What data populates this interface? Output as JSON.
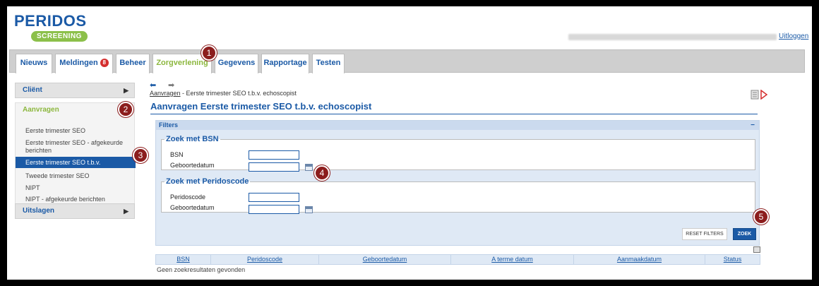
{
  "header": {
    "logo_main": "PERIDOS",
    "logo_sub": "SCREENING",
    "logout": "Uitloggen"
  },
  "tabs": [
    {
      "label": "Nieuws"
    },
    {
      "label": "Meldingen",
      "badge": "8"
    },
    {
      "label": "Beheer"
    },
    {
      "label": "Zorgverlening",
      "active": true
    },
    {
      "label": "Gegevens"
    },
    {
      "label": "Rapportage"
    },
    {
      "label": "Testen"
    }
  ],
  "sidebar": {
    "client": "Cliënt",
    "aanvragen": "Aanvragen",
    "items": [
      "Eerste trimester SEO",
      "Eerste trimester SEO - afgekeurde berichten",
      "Eerste trimester SEO t.b.v. echoscopist",
      "Tweede trimester SEO",
      "NIPT",
      "NIPT - afgekeurde berichten"
    ],
    "uitslagen": "Uitslagen"
  },
  "breadcrumb": {
    "link": "Aanvragen",
    "rest": " - Eerste trimester SEO t.b.v. echoscopist"
  },
  "page_title": "Aanvragen Eerste trimester SEO t.b.v. echoscopist",
  "filters": {
    "title": "Filters",
    "toggle": "−",
    "bsn_group": {
      "legend": "Zoek met BSN",
      "bsn_label": "BSN",
      "dob_label": "Geboortedatum"
    },
    "peridos_group": {
      "legend": "Zoek met Peridoscode",
      "code_label": "Peridoscode",
      "dob_label": "Geboortedatum"
    },
    "reset_label": "RESET FILTERS",
    "zoek_label": "ZOEK"
  },
  "results": {
    "columns": [
      "BSN",
      "Peridoscode",
      "Geboortedatum",
      "A terme datum",
      "Aanmaakdatum",
      "Status"
    ],
    "empty": "Geen zoekresultaten gevonden"
  },
  "callouts": [
    "1",
    "2",
    "3",
    "4",
    "5"
  ],
  "colors": {
    "brand_blue": "#1b5aa6",
    "brand_green": "#8cb73e",
    "callout": "#8c1d1d"
  }
}
